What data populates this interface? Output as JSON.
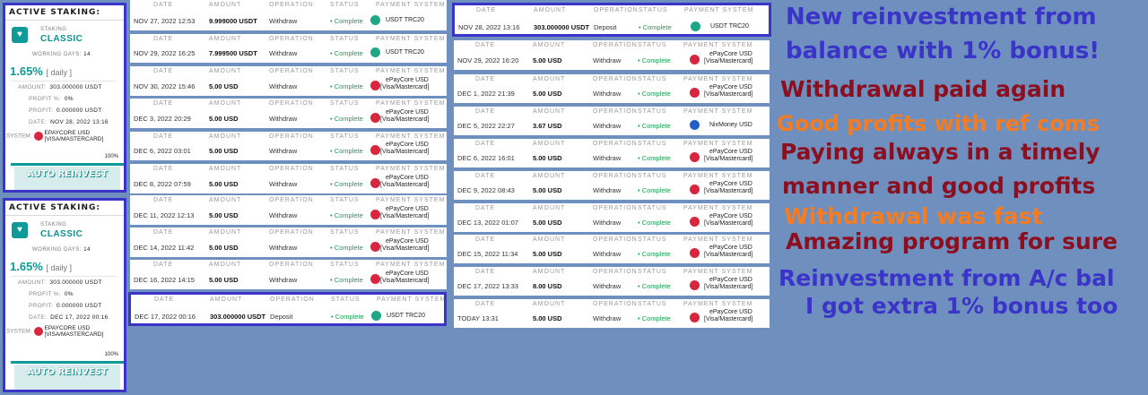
{
  "colors": {
    "background": "#6f8fbf",
    "card_border": "#3b34c8",
    "teal": "#0f9a9a",
    "complete": "#1f9d55",
    "blue_text": "#3b34c8",
    "red_text": "#8b0f1f",
    "orange_text": "#f57c20"
  },
  "staking_cards": [
    {
      "title": "ACTIVE STAKING:",
      "plan_small": "STAKING",
      "plan_name": "CLASSIC",
      "working_days_label": "WORKING DAYS:",
      "working_days": "14",
      "rate": "1.65%",
      "rate_note": "[ daily ]",
      "amount_label": "AMOUNT:",
      "amount": "303.000000 USDT",
      "profit_pct_label": "PROFIT %:",
      "profit_pct": "0%",
      "profit_label": "PROFIT:",
      "profit": "0.000000 USDT",
      "date_label": "DATE:",
      "date": "NOV 28, 2022 13:16",
      "system_label": "SYSTEM:",
      "system_line1": "EPAYCORE USD",
      "system_line2": "[VISA/MASTERCARD]",
      "progress": "100%",
      "button": "AUTO REINVEST"
    },
    {
      "title": "ACTIVE STAKING:",
      "plan_small": "STAKING",
      "plan_name": "CLASSIC",
      "working_days_label": "WORKING DAYS:",
      "working_days": "14",
      "rate": "1.65%",
      "rate_note": "[ daily ]",
      "amount_label": "AMOUNT:",
      "amount": "303.000000 USDT",
      "profit_pct_label": "PROFIT %:",
      "profit_pct": "0%",
      "profit_label": "PROFIT:",
      "profit": "0.000000 USDT",
      "date_label": "DATE:",
      "date": "DEC 17, 2022 00:16",
      "system_label": "SYSTEM:",
      "system_line1": "EPAYCORE USD",
      "system_line2": "[VISA/MASTERCARD]",
      "progress": "100%",
      "button": "AUTO REINVEST"
    }
  ],
  "headers": {
    "date": "DATE",
    "amount": "AMOUNT",
    "operation": "OPERATION",
    "status": "STATUS",
    "payment": "PAYMENT SYSTEM"
  },
  "left_rows": [
    {
      "date": "NOV 27, 2022 12:53",
      "amount": "9.999000 USDT",
      "op": "Withdraw",
      "status": "• Complete",
      "ps1": "USDT TRC20",
      "ps2": "",
      "icon": "usdt"
    },
    {
      "date": "NOV 29, 2022 16:25",
      "amount": "7.999500 USDT",
      "op": "Withdraw",
      "status": "• Complete",
      "ps1": "USDT TRC20",
      "ps2": "",
      "icon": "usdt"
    },
    {
      "date": "NOV 30, 2022 15:46",
      "amount": "5.00 USD",
      "op": "Withdraw",
      "status": "• Complete",
      "ps1": "ePayCore USD",
      "ps2": "[Visa/Mastercard]",
      "icon": "epc"
    },
    {
      "date": "DEC 3, 2022 20:29",
      "amount": "5.00 USD",
      "op": "Withdraw",
      "status": "• Complete",
      "ps1": "ePayCore USD",
      "ps2": "[Visa/Mastercard]",
      "icon": "epc"
    },
    {
      "date": "DEC 6, 2022 03:01",
      "amount": "5.00 USD",
      "op": "Withdraw",
      "status": "• Complete",
      "ps1": "ePayCore USD",
      "ps2": "[Visa/Mastercard]",
      "icon": "epc"
    },
    {
      "date": "DEC 8, 2022 07:59",
      "amount": "5.00 USD",
      "op": "Withdraw",
      "status": "• Complete",
      "ps1": "ePayCore USD",
      "ps2": "[Visa/Mastercard]",
      "icon": "epc"
    },
    {
      "date": "DEC 11, 2022 12:13",
      "amount": "5.00 USD",
      "op": "Withdraw",
      "status": "• Complete",
      "ps1": "ePayCore USD",
      "ps2": "[Visa/Mastercard]",
      "icon": "epc"
    },
    {
      "date": "DEC 14, 2022 11:42",
      "amount": "5.00 USD",
      "op": "Withdraw",
      "status": "• Complete",
      "ps1": "ePayCore USD",
      "ps2": "[Visa/Mastercard]",
      "icon": "epc"
    },
    {
      "date": "DEC 16, 2022 14:15",
      "amount": "5.00 USD",
      "op": "Withdraw",
      "status": "• Complete",
      "ps1": "ePayCore USD",
      "ps2": "[Visa/Mastercard]",
      "icon": "epc"
    },
    {
      "date": "DEC 17, 2022 00:16",
      "amount": "303.000000 USDT",
      "op": "Deposit",
      "status": "• Complete",
      "ps1": "USDT TRC20",
      "ps2": "",
      "icon": "usdt"
    }
  ],
  "right_rows": [
    {
      "date": "NOV 28, 2022 13:16",
      "amount": "303.000000 USDT",
      "op": "Deposit",
      "status": "• Complete",
      "ps1": "USDT TRC20",
      "ps2": "",
      "icon": "usdt"
    },
    {
      "date": "NOV 29, 2022 16:20",
      "amount": "5.00 USD",
      "op": "Withdraw",
      "status": "• Complete",
      "ps1": "ePayCore USD",
      "ps2": "[Visa/Mastercard]",
      "icon": "epc"
    },
    {
      "date": "DEC 1, 2022 21:39",
      "amount": "5.00 USD",
      "op": "Withdraw",
      "status": "• Complete",
      "ps1": "ePayCore USD",
      "ps2": "[Visa/Mastercard]",
      "icon": "epc"
    },
    {
      "date": "DEC 5, 2022 22:27",
      "amount": "3.67 USD",
      "op": "Withdraw",
      "status": "• Complete",
      "ps1": "NixMoney USD",
      "ps2": "",
      "icon": "nix"
    },
    {
      "date": "DEC 6, 2022 16:01",
      "amount": "5.00 USD",
      "op": "Withdraw",
      "status": "• Complete",
      "ps1": "ePayCore USD",
      "ps2": "[Visa/Mastercard]",
      "icon": "epc"
    },
    {
      "date": "DEC 9, 2022 08:43",
      "amount": "5.00 USD",
      "op": "Withdraw",
      "status": "• Complete",
      "ps1": "ePayCore USD",
      "ps2": "[Visa/Mastercard]",
      "icon": "epc"
    },
    {
      "date": "DEC 13, 2022 01:07",
      "amount": "5.00 USD",
      "op": "Withdraw",
      "status": "• Complete",
      "ps1": "ePayCore USD",
      "ps2": "[Visa/Mastercard]",
      "icon": "epc"
    },
    {
      "date": "DEC 15, 2022 11:34",
      "amount": "5.00 USD",
      "op": "Withdraw",
      "status": "• Complete",
      "ps1": "ePayCore USD",
      "ps2": "[Visa/Mastercard]",
      "icon": "epc"
    },
    {
      "date": "DEC 17, 2022 13:33",
      "amount": "8.00 USD",
      "op": "Withdraw",
      "status": "• Complete",
      "ps1": "ePayCore USD",
      "ps2": "[Visa/Mastercard]",
      "icon": "epc"
    },
    {
      "date": "TODAY 13:31",
      "amount": "5.00 USD",
      "op": "Withdraw",
      "status": "• Complete",
      "ps1": "ePayCore USD",
      "ps2": "[Visa/Mastercard]",
      "icon": "epc"
    }
  ],
  "annotations": {
    "new_reinvest_1": "New reinvestment from",
    "new_reinvest_2": "balance with 1% bonus!",
    "withdrawal_paid": "Withdrawal paid again",
    "good_profits": "Good profits with ref coms",
    "paying_timely_1": "Paying always in a timely",
    "paying_timely_2": "manner and good profits",
    "withdrawal_fast": "Withdrawal was fast",
    "amazing": "Amazing program for sure",
    "reinvest_bal": "Reinvestment from A/c bal",
    "extra_bonus": "I got extra 1% bonus too"
  }
}
